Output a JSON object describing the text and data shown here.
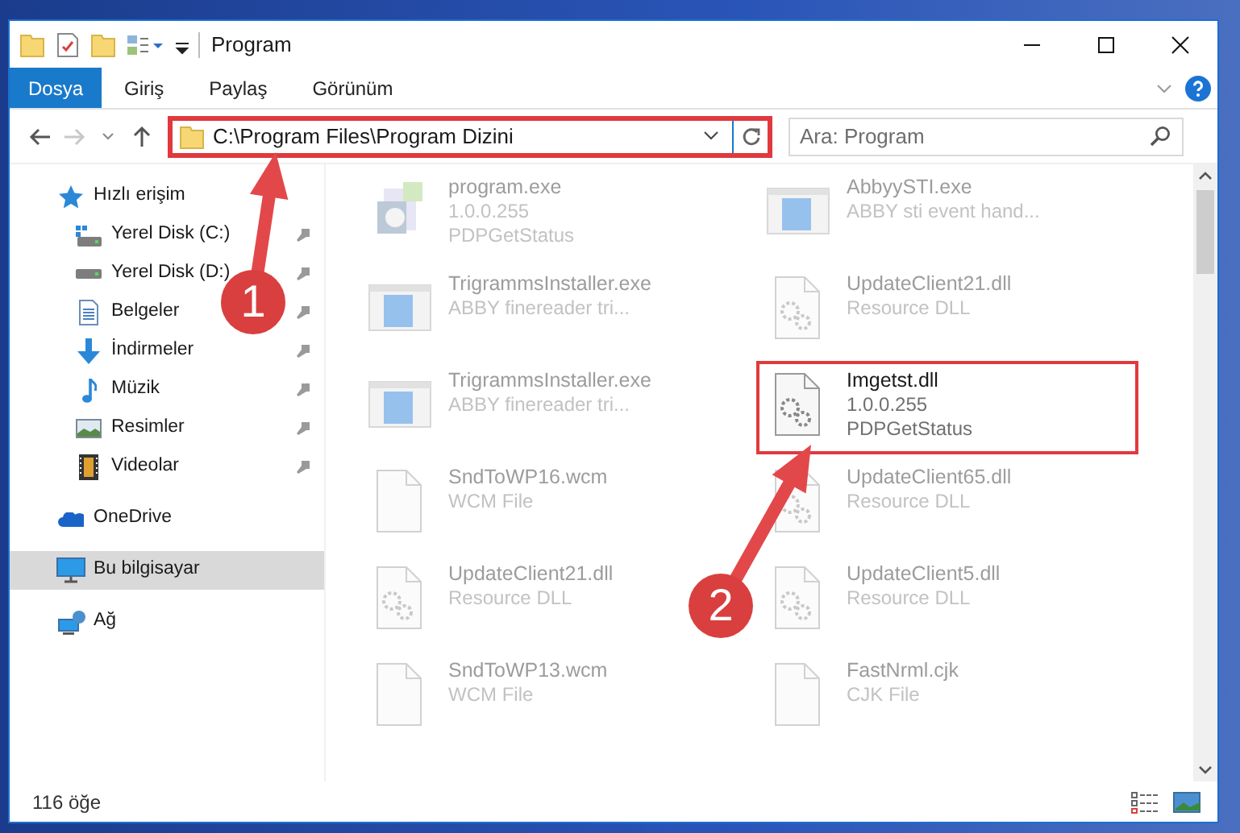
{
  "title_bar": {
    "title": "Program"
  },
  "ribbon": {
    "tabs": [
      {
        "label": "Dosya",
        "kind": "file"
      },
      {
        "label": "Giriş",
        "kind": "tab"
      },
      {
        "label": "Paylaş",
        "kind": "tab"
      },
      {
        "label": "Görünüm",
        "kind": "tab"
      }
    ]
  },
  "address_bar": {
    "path": "C:\\Program Files\\Program Dizini",
    "highlighted": true
  },
  "search": {
    "placeholder": "Ara: Program"
  },
  "sidebar": {
    "items": [
      {
        "label": "Hızlı erişim",
        "kind": "quick",
        "selected": false,
        "children": [
          {
            "label": "Yerel Disk (C:)",
            "kind": "system-drive",
            "pinned": true,
            "selected": false
          },
          {
            "label": "Yerel Disk (D:)",
            "kind": "drive",
            "pinned": true,
            "selected": false
          },
          {
            "label": "Belgeler",
            "kind": "documents",
            "pinned": true,
            "selected": false
          },
          {
            "label": "İndirmeler",
            "kind": "downloads",
            "pinned": true,
            "selected": false
          },
          {
            "label": "Müzik",
            "kind": "music",
            "pinned": true,
            "selected": false
          },
          {
            "label": "Resimler",
            "kind": "pictures",
            "pinned": true,
            "selected": false
          },
          {
            "label": "Videolar",
            "kind": "videos",
            "pinned": true,
            "selected": false
          }
        ]
      },
      {
        "label": "OneDrive",
        "kind": "cloud",
        "selected": false
      },
      {
        "label": "Bu bilgisayar",
        "kind": "computer",
        "selected": true
      },
      {
        "label": "Ağ",
        "kind": "network",
        "selected": false
      }
    ]
  },
  "files": [
    {
      "name": "program.exe",
      "details": [
        "1.0.0.255",
        "PDPGetStatus"
      ],
      "kind": "app",
      "highlighted": false
    },
    {
      "name": "AbbyySTI.exe",
      "details": [
        "ABBY sti event hand..."
      ],
      "kind": "window",
      "highlighted": false
    },
    {
      "name": "TrigrammsInstaller.exe",
      "details": [
        "ABBY finereader tri..."
      ],
      "kind": "window",
      "highlighted": false
    },
    {
      "name": "UpdateClient21.dll",
      "details": [
        "Resource DLL"
      ],
      "kind": "dll",
      "highlighted": false
    },
    {
      "name": "TrigrammsInstaller.exe",
      "details": [
        "ABBY finereader tri..."
      ],
      "kind": "window",
      "highlighted": false
    },
    {
      "name": "Imgetst.dll",
      "details": [
        "1.0.0.255",
        "PDPGetStatus"
      ],
      "kind": "dll",
      "highlighted": true
    },
    {
      "name": "SndToWP16.wcm",
      "details": [
        "WCM File"
      ],
      "kind": "file",
      "highlighted": false
    },
    {
      "name": "UpdateClient65.dll",
      "details": [
        "Resource DLL"
      ],
      "kind": "dll",
      "highlighted": false
    },
    {
      "name": "UpdateClient21.dll",
      "details": [
        "Resource DLL"
      ],
      "kind": "dll",
      "highlighted": false
    },
    {
      "name": "UpdateClient5.dll",
      "details": [
        "Resource DLL"
      ],
      "kind": "dll",
      "highlighted": false
    },
    {
      "name": "SndToWP13.wcm",
      "details": [
        "WCM File"
      ],
      "kind": "file",
      "highlighted": false
    },
    {
      "name": "FastNrml.cjk",
      "details": [
        "CJK File"
      ],
      "kind": "file",
      "highlighted": false
    }
  ],
  "status_bar": {
    "count": "116 öğe"
  },
  "annotations": [
    {
      "number": "1"
    },
    {
      "number": "2"
    }
  ]
}
